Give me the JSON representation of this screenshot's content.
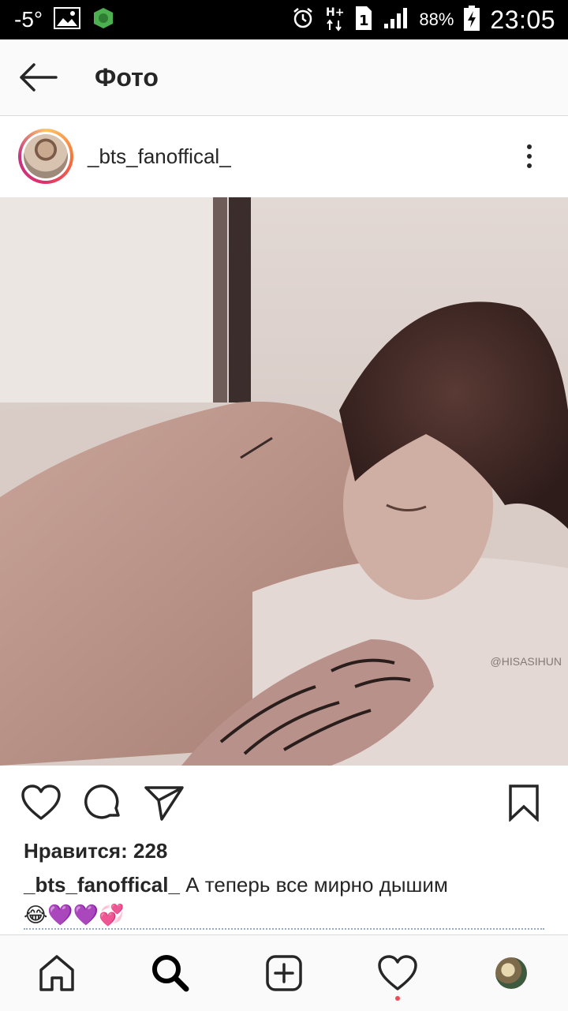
{
  "status_bar": {
    "temperature": "-5°",
    "network": "H+",
    "sim": "1",
    "battery": "88%",
    "time": "23:05"
  },
  "header": {
    "title": "Фото"
  },
  "post": {
    "username": "_bts_fanoffical_",
    "image_watermark": "@HISASIHUN",
    "likes_text": "Нравится: 228",
    "caption_user": "_bts_fanoffical_",
    "caption_text": "А теперь все мирно дышим",
    "caption_emoji": "😂💜💜💞"
  },
  "bottom_nav": {
    "items": [
      "home",
      "search",
      "new-post",
      "activity",
      "profile"
    ]
  }
}
